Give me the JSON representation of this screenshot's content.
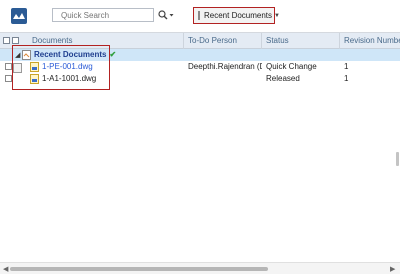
{
  "toolbar": {
    "search_placeholder": "Quick Search",
    "recent_label": "Recent Documents"
  },
  "grid": {
    "columns": [
      "Documents",
      "To-Do Person",
      "Status",
      "Revision Number"
    ],
    "group": {
      "label": "Recent Documents"
    },
    "rows": [
      {
        "document": "1-PE-001.dwg",
        "todo_person": "Deepthi.Rajendran (D...",
        "status": "Quick Change",
        "revision": "1"
      },
      {
        "document": "1-A1-1001.dwg",
        "todo_person": "",
        "status": "Released",
        "revision": "1"
      }
    ]
  },
  "colors": {
    "highlight_border": "#b22222",
    "group_row_bg": "#cfe6f8",
    "header_bg": "#e4ebf4",
    "link": "#2a5bd7"
  }
}
